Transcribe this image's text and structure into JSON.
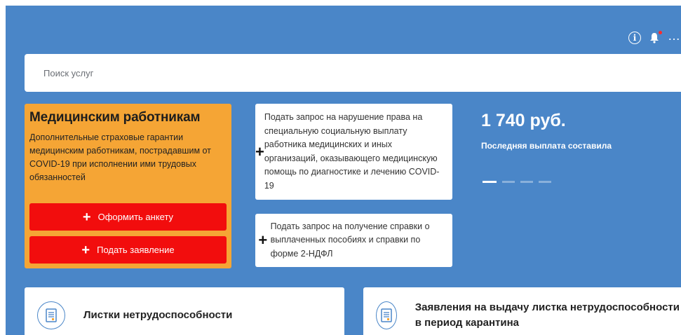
{
  "header": {
    "icons": [
      "info-icon",
      "bell-icon",
      "more-icon"
    ],
    "notification_color": "#ff2a2a"
  },
  "search": {
    "placeholder": "Поиск услуг"
  },
  "med_card": {
    "title": "Медицинским работникам",
    "description": "Дополнительные страховые гарантии медицинским работникам, пострадавшим от COVID-19 при исполнении ими трудовых обязанностей",
    "button_anketa": "Оформить анкету",
    "button_zayav": "Подать заявление",
    "accent": "#f5a535",
    "button_color": "#f20d0d"
  },
  "requests": [
    {
      "label": "Подать запрос на нарушение права на специальную социальную выплату работника медицинских и иных организаций, оказывающего медицинскую помощь по диагностике и лечению COVID-19"
    },
    {
      "label": "Подать запрос на получение справки о выплаченных пособиях и справки по форме 2-НДФЛ"
    }
  ],
  "payment": {
    "amount": "1 740 руб.",
    "label": "Последняя выплата составила",
    "slides_total": 4,
    "slide_active": 1
  },
  "tiles": [
    {
      "title": "Листки нетрудоспособности",
      "icon": "document-icon"
    },
    {
      "title": "Заявления на выдачу листка нетрудоспособности в период карантина",
      "icon": "document-icon"
    }
  ],
  "theme": {
    "primary": "#4a86c8"
  }
}
